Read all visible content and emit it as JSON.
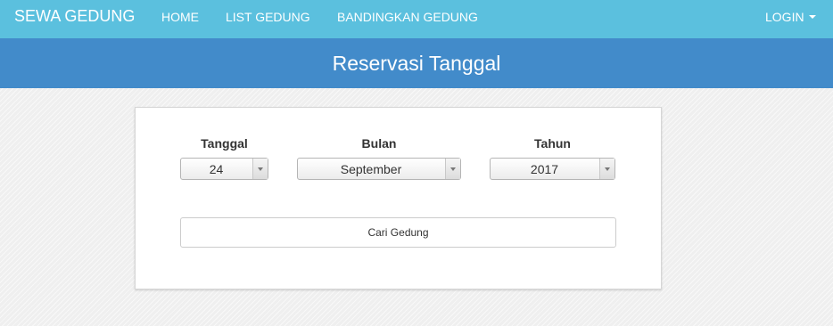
{
  "navbar": {
    "brand": "SEWA GEDUNG",
    "items": [
      "HOME",
      "LIST GEDUNG",
      "BANDINGKAN GEDUNG"
    ],
    "login": "LOGIN",
    "background": "#5bc0de"
  },
  "header": {
    "title": "Reservasi Tanggal",
    "background": "#428bca"
  },
  "form": {
    "day": {
      "label": "Tanggal",
      "value": "24"
    },
    "month": {
      "label": "Bulan",
      "value": "September"
    },
    "year": {
      "label": "Tahun",
      "value": "2017"
    },
    "submit": "Cari Gedung"
  },
  "icons": {
    "login_caret": "chevron-down-icon",
    "select_arrow": "chevron-down-icon"
  }
}
